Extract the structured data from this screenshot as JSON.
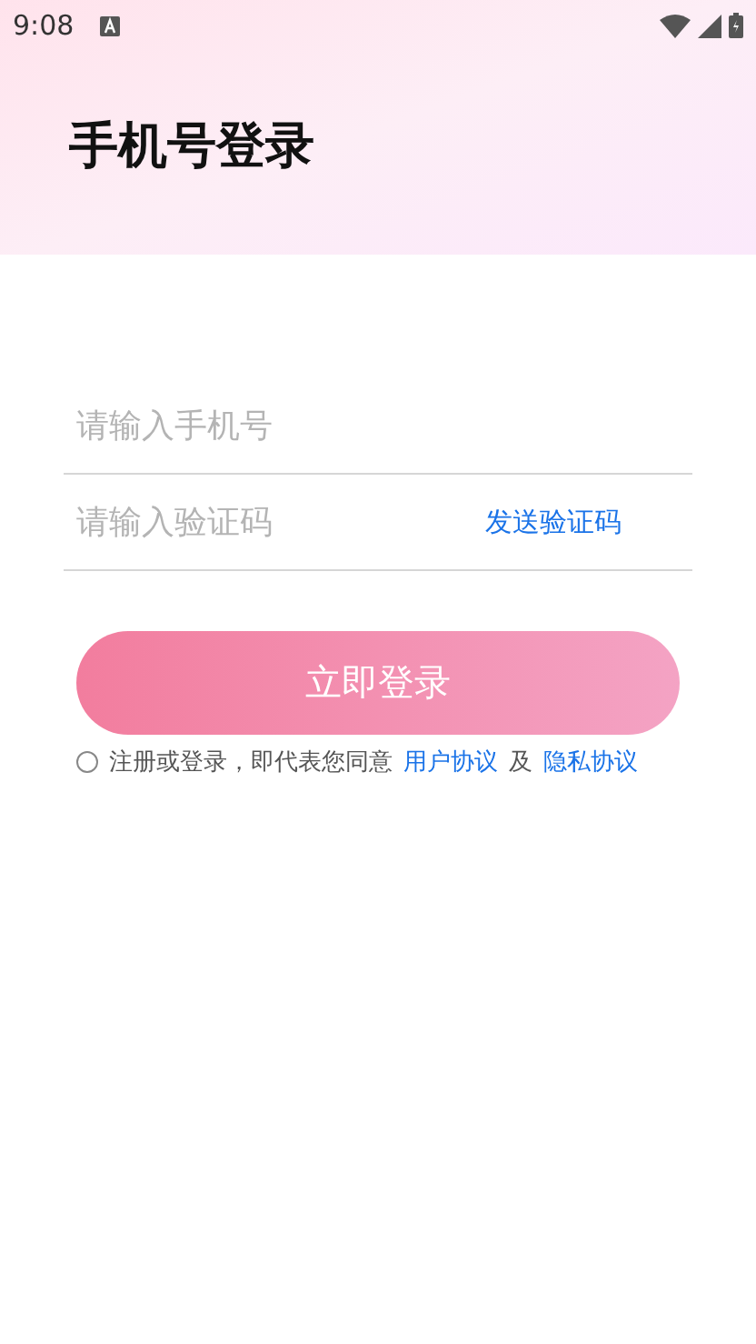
{
  "status_bar": {
    "time": "9:08"
  },
  "title": "手机号登录",
  "phone_field": {
    "placeholder": "请输入手机号"
  },
  "code_field": {
    "placeholder": "请输入验证码"
  },
  "send_code_link": "发送验证码",
  "login_button": {
    "label": "立即登录",
    "disabled": true
  },
  "agreement": {
    "checked": false,
    "text": "注册或登录，即代表您同意",
    "user_agreement": "用户协议",
    "joiner": "及",
    "privacy_policy": "隐私协议"
  }
}
